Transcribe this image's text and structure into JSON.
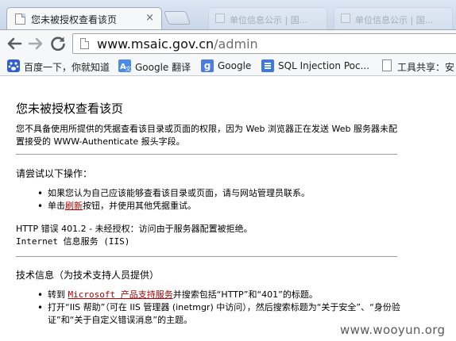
{
  "tab": {
    "title": "您未被授权查看该页",
    "close": "×"
  },
  "faded_tabs": [
    "单位信息公示 | 国...",
    "单位信息公示 | 国..."
  ],
  "omnibox": {
    "url_host": "www.msaic.gov.cn",
    "url_path": "/admin"
  },
  "bookmarks": [
    {
      "label": "百度一下，你就知道",
      "icon": "baidu-paw-icon"
    },
    {
      "label": "Google 翻译",
      "icon": "translate-icon"
    },
    {
      "label": "Google",
      "icon": "google-icon"
    },
    {
      "label": "SQL Injection Poc...",
      "icon": "document-icon"
    },
    {
      "label": "工具共享：安",
      "icon": "page-icon"
    }
  ],
  "content": {
    "title": "您未被授权查看该页",
    "para": "您不具备使用所提供的凭据查看该目录或页面的权限，因为 Web 浏览器正在发送 Web 服务器未配置接受的 WWW-Authenticate 报头字段。",
    "try_heading": "请尝试以下操作：",
    "try_items": {
      "item1": "如果您认为自己应该能够查看该目录或页面，请与网站管理员联系。",
      "item2_pre": "单击",
      "item2_link": "刷新",
      "item2_post": "按钮，并使用其他凭据重试。"
    },
    "error_line1": "HTTP 错误 401.2 - 未经授权：访问由于服务器配置被拒绝。",
    "error_line2": "Internet 信息服务 (IIS)",
    "tech_heading": "技术信息（为技术支持人员提供）",
    "tech_items": {
      "item1_pre": "转到 ",
      "item1_link": "Microsoft 产品支持服务",
      "item1_post": "并搜索包括“HTTP”和“401”的标题。",
      "item2": "打开“IIS 帮助”（可在 IIS 管理器 (inetmgr) 中访问），然后搜索标题为“关于安全”、“身份验证”和“关于自定义错误消息”的主题。"
    }
  },
  "watermark": "www.wooyun.org"
}
